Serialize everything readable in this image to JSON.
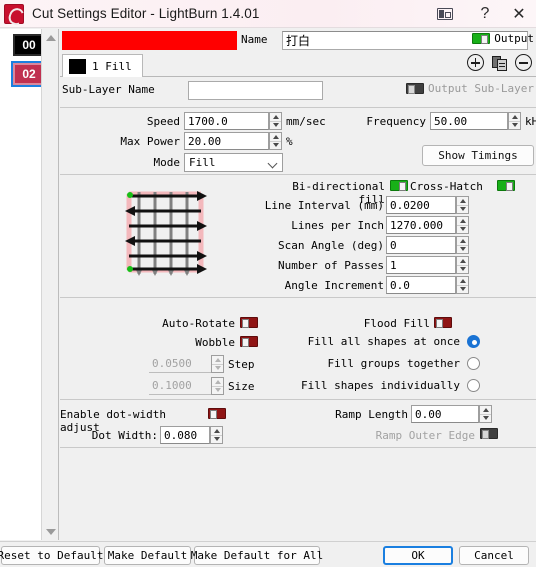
{
  "window": {
    "title": "Cut Settings Editor - LightBurn 1.4.01",
    "app_icon": "lightburn-flame-icon",
    "dock_icon": "dock-panel-icon",
    "help_label": "?",
    "close_label": "✕"
  },
  "layer_list": {
    "layers": [
      {
        "index": "00",
        "color": "#000000",
        "selected": false
      },
      {
        "index": "02",
        "color": "#c03050",
        "selected": true
      }
    ]
  },
  "header": {
    "layer_color": "#ff0000",
    "name_label": "Name",
    "name_value": "打白",
    "output_label": "Output",
    "output_on": true
  },
  "sublayer": {
    "tab_label": "1 Fill",
    "tab_swatch": "#000000",
    "add_icon": "add-circle-icon",
    "duplicate_icon": "duplicate-icon",
    "remove_icon": "remove-circle-icon",
    "name_label": "Sub-Layer Name",
    "name_value": "",
    "output_sublayer_label": "Output Sub-Layer",
    "output_sublayer_enabled": false
  },
  "cut_params": {
    "speed_label": "Speed",
    "speed_value": "1700.0",
    "speed_unit": "mm/sec",
    "max_power_label": "Max Power",
    "max_power_value": "20.00",
    "max_power_unit": "%",
    "mode_label": "Mode",
    "mode_value": "Fill",
    "frequency_label": "Frequency",
    "frequency_value": "50.00",
    "frequency_unit": "kHz",
    "show_timings_label": "Show Timings"
  },
  "fill": {
    "bidirectional_label": "Bi-directional fill",
    "bidirectional_on": true,
    "crosshatch_label": "Cross-Hatch",
    "crosshatch_on": true,
    "line_interval_label": "Line Interval (mm)",
    "line_interval_value": "0.0200",
    "lines_per_inch_label": "Lines per Inch",
    "lines_per_inch_value": "1270.000",
    "scan_angle_label": "Scan Angle (deg)",
    "scan_angle_value": "0",
    "number_of_passes_label": "Number of Passes",
    "number_of_passes_value": "1",
    "angle_increment_label": "Angle Increment",
    "angle_increment_value": "0.0",
    "preview_icon": "crosshatch-fill-preview"
  },
  "options": {
    "auto_rotate_label": "Auto-Rotate",
    "auto_rotate_on": false,
    "flood_fill_label": "Flood Fill",
    "flood_fill_on": false,
    "wobble_label": "Wobble",
    "wobble_on": false,
    "step_label": "Step",
    "step_value": "0.0500",
    "size_label": "Size",
    "size_value": "0.1000",
    "fill_mode_options": [
      {
        "label": "Fill all shapes at once",
        "selected": true
      },
      {
        "label": "Fill groups together",
        "selected": false
      },
      {
        "label": "Fill shapes individually",
        "selected": false
      }
    ]
  },
  "dot_ramp": {
    "enable_dot_width_label": "Enable dot-width adjust",
    "enable_dot_width_on": false,
    "dot_width_label": "Dot Width:",
    "dot_width_value": "0.080",
    "ramp_length_label": "Ramp Length",
    "ramp_length_value": "0.00",
    "ramp_outer_edge_label": "Ramp Outer Edge",
    "ramp_outer_edge_enabled": false
  },
  "footer": {
    "reset_to_default": "Reset to Default",
    "make_default": "Make Default",
    "make_default_for_all": "Make Default for All",
    "ok": "OK",
    "cancel": "Cancel"
  }
}
